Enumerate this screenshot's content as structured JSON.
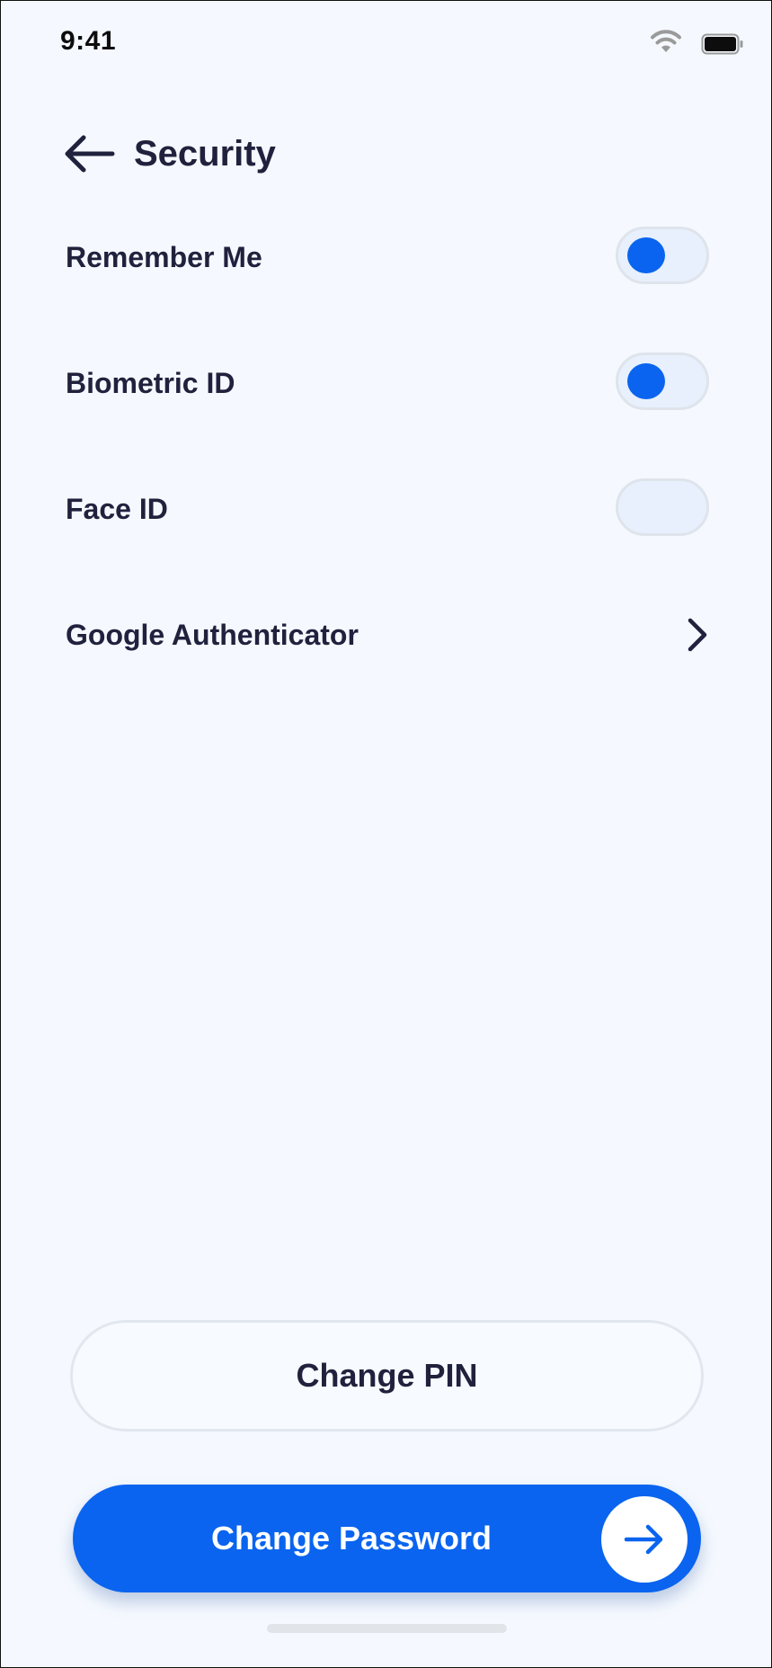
{
  "status_bar": {
    "time": "9:41",
    "wifi_icon": "wifi-icon",
    "battery_icon": "battery-icon"
  },
  "header": {
    "back_icon": "arrow-left-icon",
    "title": "Security"
  },
  "settings": [
    {
      "label": "Remember Me",
      "control": "toggle",
      "enabled": true
    },
    {
      "label": "Biometric ID",
      "control": "toggle",
      "enabled": true
    },
    {
      "label": "Face ID",
      "control": "toggle",
      "enabled": false
    },
    {
      "label": "Google Authenticator",
      "control": "chevron-right-icon"
    }
  ],
  "actions": {
    "change_pin_label": "Change PIN",
    "change_password_label": "Change Password",
    "change_password_icon": "arrow-right-icon"
  },
  "colors": {
    "accent": "#0a64ef",
    "background": "#f5f9ff",
    "text": "#20223d",
    "toggle_track": "#e7f0fc"
  }
}
